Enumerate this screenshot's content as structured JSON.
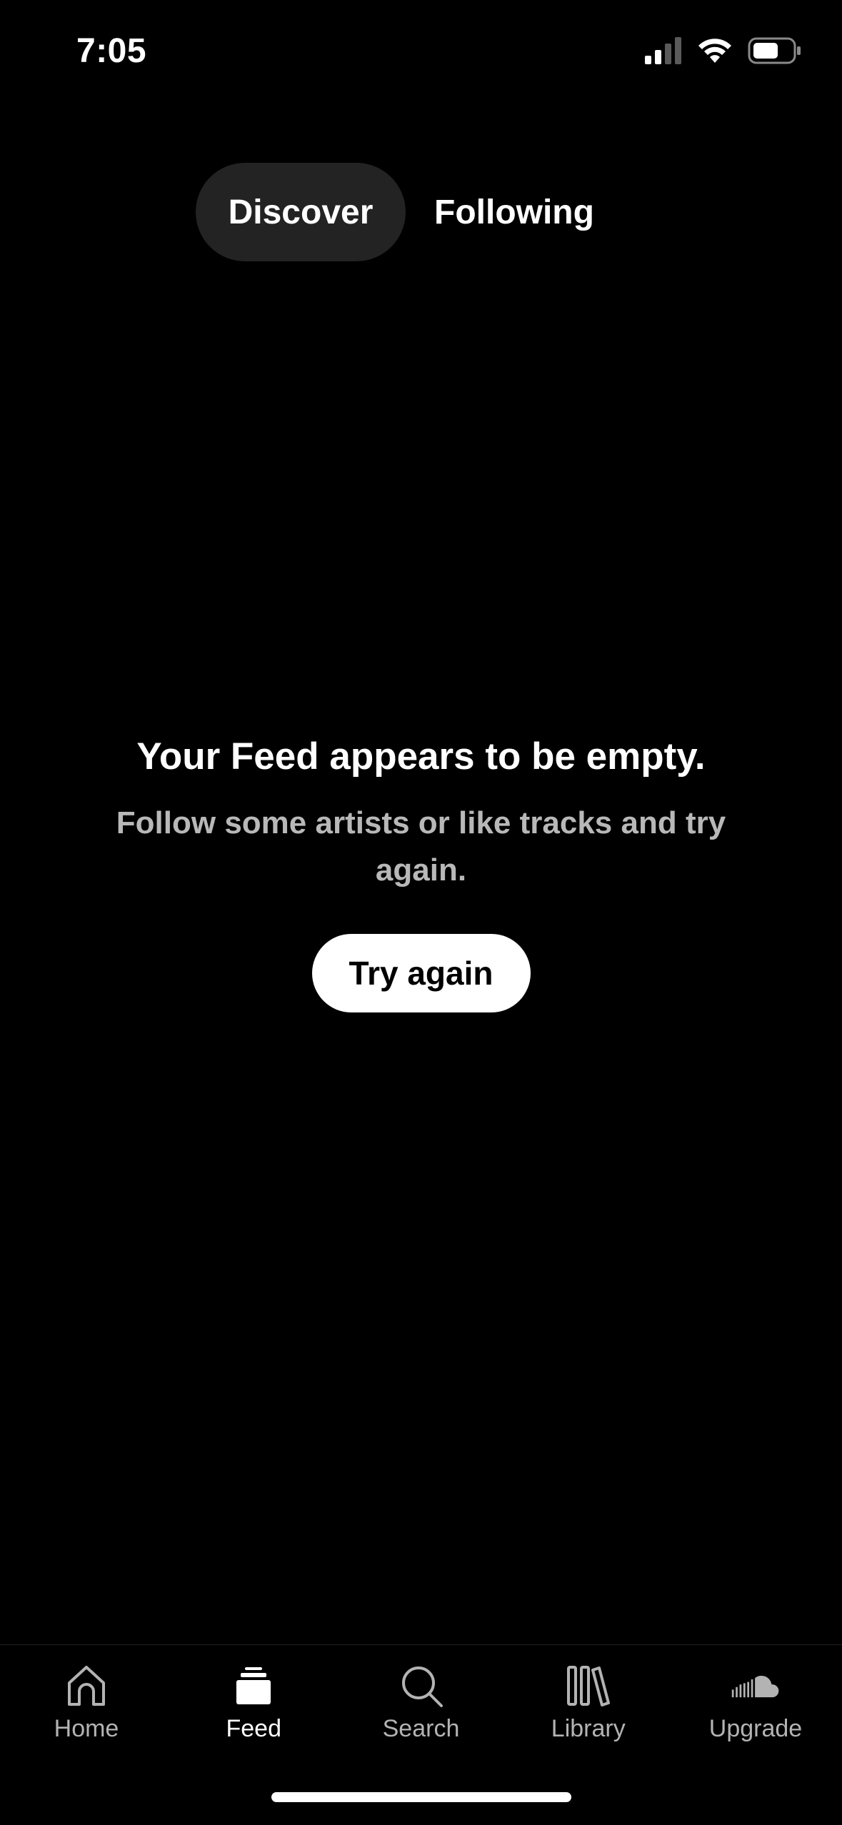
{
  "status_bar": {
    "time": "7:05"
  },
  "tabs": [
    {
      "label": "Discover",
      "active": true
    },
    {
      "label": "Following",
      "active": false
    }
  ],
  "empty_state": {
    "title": "Your Feed appears to be empty.",
    "subtitle": "Follow some artists or like tracks and try again.",
    "button_label": "Try again"
  },
  "bottom_nav": [
    {
      "label": "Home",
      "icon": "home-icon",
      "active": false
    },
    {
      "label": "Feed",
      "icon": "feed-icon",
      "active": true
    },
    {
      "label": "Search",
      "icon": "search-icon",
      "active": false
    },
    {
      "label": "Library",
      "icon": "library-icon",
      "active": false
    },
    {
      "label": "Upgrade",
      "icon": "soundcloud-icon",
      "active": false
    }
  ],
  "colors": {
    "background": "#000000",
    "active_tab_bg": "#232323",
    "subtitle_text": "#b8b8b8",
    "inactive_nav": "#b3b3b3"
  }
}
